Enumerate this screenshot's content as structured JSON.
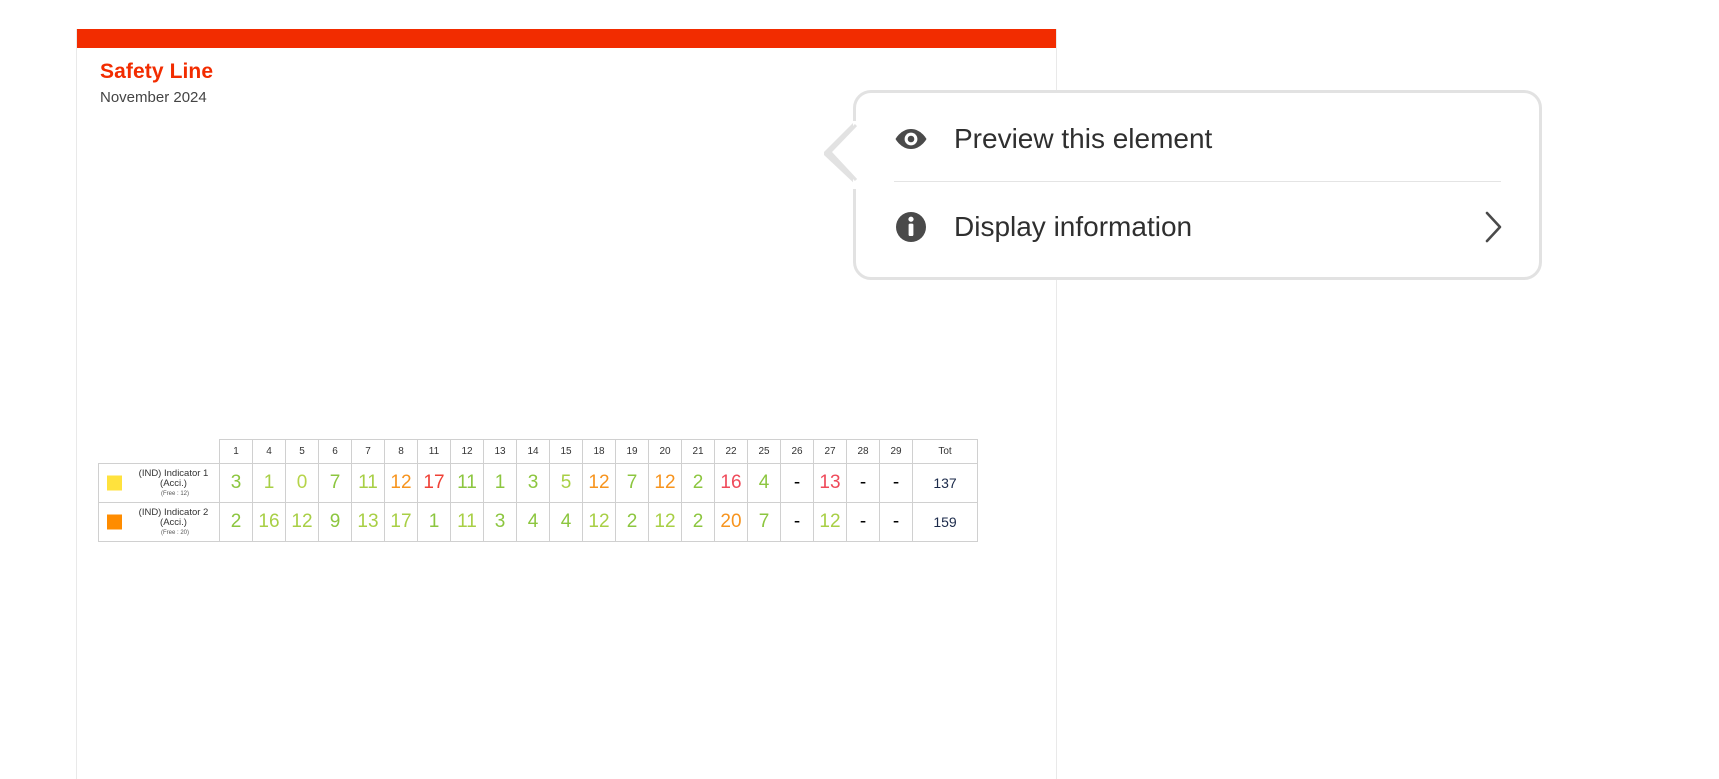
{
  "report": {
    "title": "Safety Line",
    "subtitle": "November 2024",
    "accent_color": "#f22c00"
  },
  "table": {
    "columns": [
      "1",
      "4",
      "5",
      "6",
      "7",
      "8",
      "11",
      "12",
      "13",
      "14",
      "15",
      "18",
      "19",
      "20",
      "21",
      "22",
      "25",
      "26",
      "27",
      "28",
      "29"
    ],
    "total_column_label": "Tot",
    "rows": [
      {
        "swatch_color": "#ffe23d",
        "label": "(IND) Indicator 1 (Acci.)",
        "label_line1": "(IND) Indicator 1",
        "label_line2": "(Acci.)",
        "sublabel": "(Free : 12)",
        "cells": [
          {
            "value": "3",
            "color": "#8cc63f"
          },
          {
            "value": "1",
            "color": "#a8cf45"
          },
          {
            "value": "0",
            "color": "#b6d44a"
          },
          {
            "value": "7",
            "color": "#8cc63f"
          },
          {
            "value": "11",
            "color": "#a8cf45"
          },
          {
            "value": "12",
            "color": "#f7941e"
          },
          {
            "value": "17",
            "color": "#ef4136"
          },
          {
            "value": "11",
            "color": "#8cc63f"
          },
          {
            "value": "1",
            "color": "#8cc63f"
          },
          {
            "value": "3",
            "color": "#8cc63f"
          },
          {
            "value": "5",
            "color": "#a8cf45"
          },
          {
            "value": "12",
            "color": "#f7941e"
          },
          {
            "value": "7",
            "color": "#8cc63f"
          },
          {
            "value": "12",
            "color": "#f7941e"
          },
          {
            "value": "2",
            "color": "#8cc63f"
          },
          {
            "value": "16",
            "color": "#ef4a5a"
          },
          {
            "value": "4",
            "color": "#8cc63f"
          },
          {
            "value": "-",
            "color": "#000000"
          },
          {
            "value": "13",
            "color": "#ef4a5a"
          },
          {
            "value": "-",
            "color": "#000000"
          },
          {
            "value": "-",
            "color": "#000000"
          }
        ],
        "total": "137"
      },
      {
        "swatch_color": "#ff8c00",
        "label": "(IND) Indicator 2 (Acci.)",
        "label_line1": "(IND) Indicator 2",
        "label_line2": "(Acci.)",
        "sublabel": "(Free : 20)",
        "cells": [
          {
            "value": "2",
            "color": "#8cc63f"
          },
          {
            "value": "16",
            "color": "#a8cf45"
          },
          {
            "value": "12",
            "color": "#a8cf45"
          },
          {
            "value": "9",
            "color": "#8cc63f"
          },
          {
            "value": "13",
            "color": "#a8cf45"
          },
          {
            "value": "17",
            "color": "#a8cf45"
          },
          {
            "value": "1",
            "color": "#8cc63f"
          },
          {
            "value": "11",
            "color": "#a8cf45"
          },
          {
            "value": "3",
            "color": "#8cc63f"
          },
          {
            "value": "4",
            "color": "#8cc63f"
          },
          {
            "value": "4",
            "color": "#8cc63f"
          },
          {
            "value": "12",
            "color": "#a8cf45"
          },
          {
            "value": "2",
            "color": "#8cc63f"
          },
          {
            "value": "12",
            "color": "#a8cf45"
          },
          {
            "value": "2",
            "color": "#8cc63f"
          },
          {
            "value": "20",
            "color": "#f7941e"
          },
          {
            "value": "7",
            "color": "#8cc63f"
          },
          {
            "value": "-",
            "color": "#000000"
          },
          {
            "value": "12",
            "color": "#a8cf45"
          },
          {
            "value": "-",
            "color": "#000000"
          },
          {
            "value": "-",
            "color": "#000000"
          }
        ],
        "total": "159"
      }
    ]
  },
  "context_menu": {
    "items": [
      {
        "label": "Preview this element",
        "icon": "eye-icon",
        "has_chevron": false
      },
      {
        "label": "Display information",
        "icon": "info-icon",
        "has_chevron": true
      }
    ]
  }
}
